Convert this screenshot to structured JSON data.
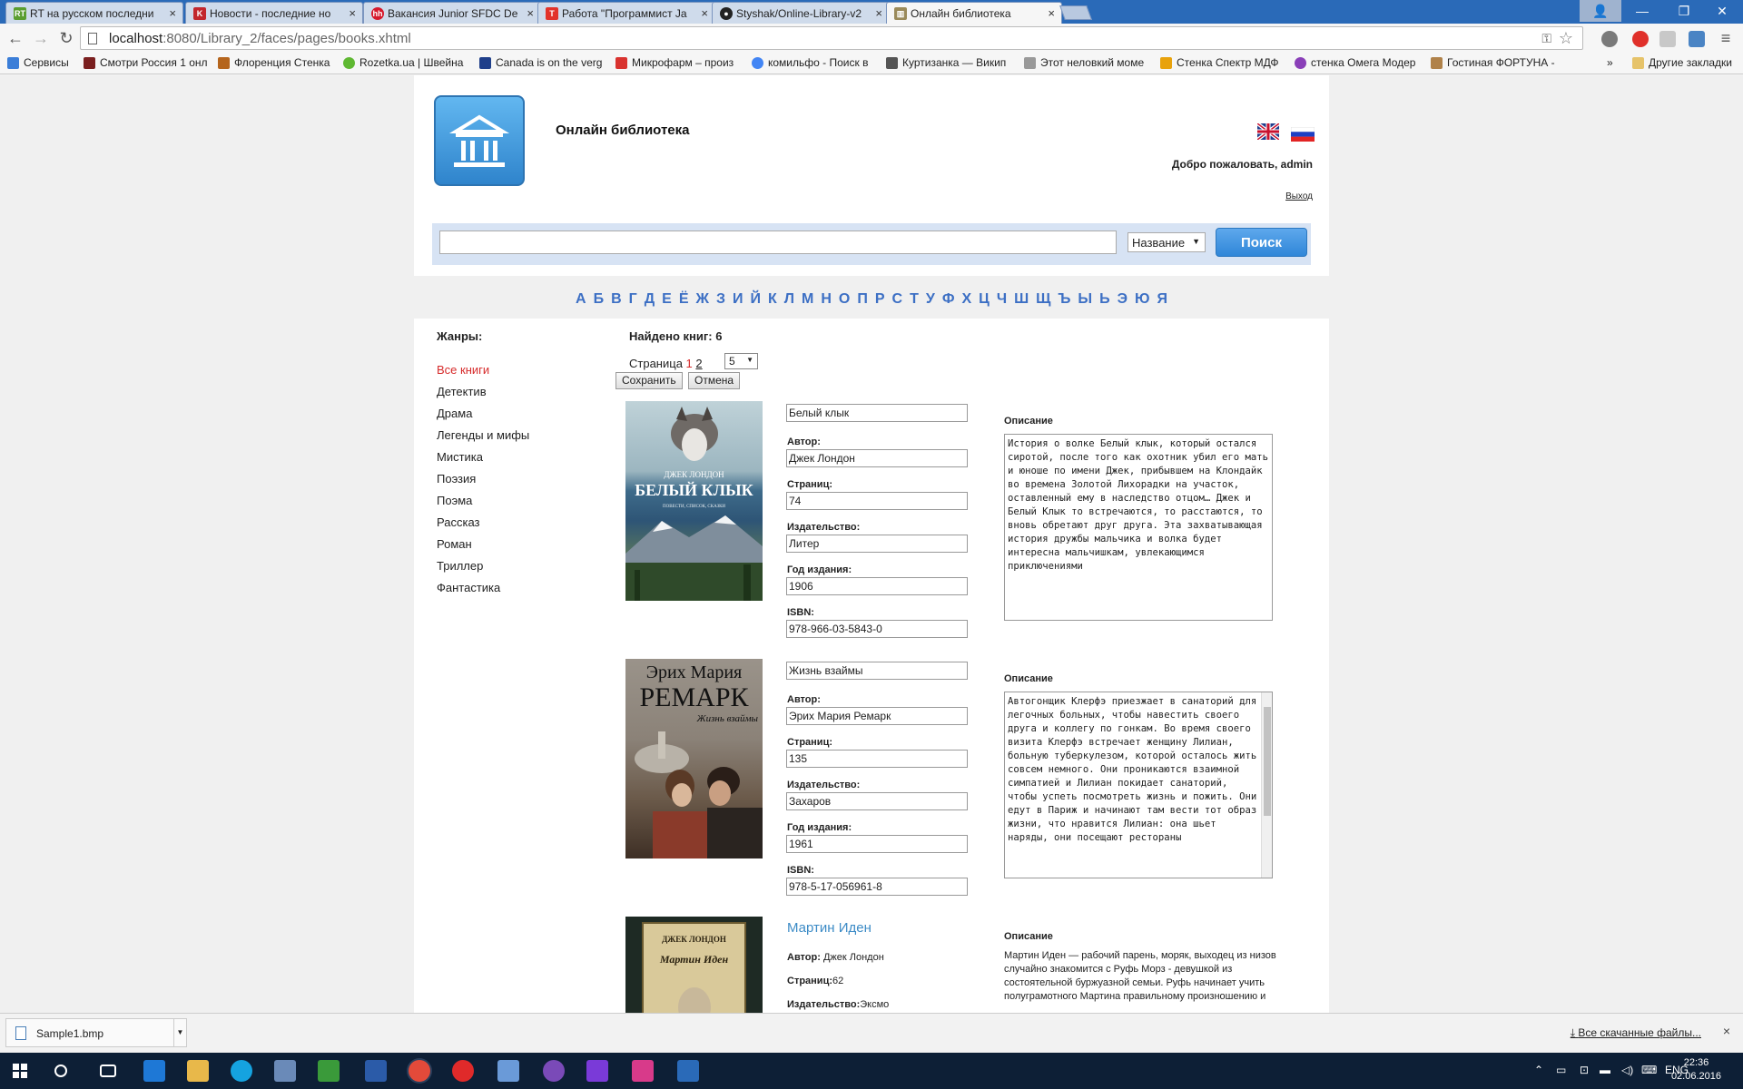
{
  "browser": {
    "tabs": [
      {
        "label": "RT на русском последни",
        "icon": "rt-favicon",
        "color": "#5a9e2f"
      },
      {
        "label": "Новости - последние но",
        "icon": "k-favicon",
        "color": "#c2272d"
      },
      {
        "label": "Вакансия Junior SFDC De",
        "icon": "hh-favicon",
        "color": "#d6192c"
      },
      {
        "label": "Работа \"Программист Ja",
        "icon": "rabota-favicon",
        "color": "#e2332a"
      },
      {
        "label": "Styshak/Online-Library-v2",
        "icon": "github-favicon",
        "color": "#222222"
      },
      {
        "label": "Онлайн библиотека",
        "icon": "library-favicon",
        "color": "#9a8a5a",
        "active": true
      }
    ],
    "url_host": "localhost",
    "url_path": ":8080/Library_2/faces/pages/books.xhtml",
    "bookmarks": [
      {
        "label": "Сервисы",
        "icon": "apps-icon",
        "color": "#3b7ed8"
      },
      {
        "label": "Смотри Россия 1 онл",
        "icon": "russia1-favicon",
        "color": "#7a1f1f"
      },
      {
        "label": "Флоренция Стенка",
        "icon": "florence-favicon",
        "color": "#b5651d"
      },
      {
        "label": "Rozetka.ua | Швейна",
        "icon": "rozetka-favicon",
        "color": "#5fb832"
      },
      {
        "label": "Canada is on the verg",
        "icon": "wsws-favicon",
        "color": "#1f3f8a"
      },
      {
        "label": "Микрофарм – произ",
        "icon": "microfarm-favicon",
        "color": "#d9332f"
      },
      {
        "label": "комильфо - Поиск в",
        "icon": "google-favicon",
        "color": "#4285f4"
      },
      {
        "label": "Куртизанка — Викип",
        "icon": "wikipedia-favicon",
        "color": "#555555"
      },
      {
        "label": "Этот неловкий моме",
        "icon": "ex-favicon",
        "color": "#999999"
      },
      {
        "label": "Стенка Спектр МДФ",
        "icon": "m-favicon",
        "color": "#e8a20c"
      },
      {
        "label": "стенка Омега Модер",
        "icon": "omega-favicon",
        "color": "#8a3fb8"
      },
      {
        "label": "Гостиная ФОРТУНА -",
        "icon": "fortuna-favicon",
        "color": "#b0824a"
      }
    ],
    "other_bookmarks": "Другие закладки",
    "more_bookmarks": "»"
  },
  "site": {
    "title": "Онлайн библиотека",
    "welcome": "Добро пожаловать, admin",
    "logout": "Выход",
    "search_value": "",
    "search_field_selected": "Название",
    "search_button": "Поиск"
  },
  "alphabet": [
    "А",
    "Б",
    "В",
    "Г",
    "Д",
    "Е",
    "Ё",
    "Ж",
    "З",
    "И",
    "Й",
    "К",
    "Л",
    "М",
    "Н",
    "О",
    "П",
    "Р",
    "С",
    "Т",
    "У",
    "Ф",
    "Х",
    "Ц",
    "Ч",
    "Ш",
    "Щ",
    "Ъ",
    "Ы",
    "Ь",
    "Э",
    "Ю",
    "Я"
  ],
  "genres": {
    "title": "Жанры:",
    "items": [
      "Все книги",
      "Детектив",
      "Драма",
      "Легенды и мифы",
      "Мистика",
      "Поэзия",
      "Поэма",
      "Рассказ",
      "Роман",
      "Триллер",
      "Фантастика"
    ]
  },
  "results": {
    "found_label": "Найдено книг: 6",
    "page_label": "Страница",
    "pages": [
      "1",
      "2"
    ],
    "page_size": "5",
    "save_button": "Сохранить",
    "cancel_button": "Отмена"
  },
  "labels": {
    "author": "Автор:",
    "pages": "Страниц:",
    "publisher": "Издательство:",
    "year": "Год издания:",
    "isbn": "ISBN:",
    "description": "Описание"
  },
  "books": [
    {
      "title": "Белый клык",
      "author": "Джек Лондон",
      "pages": "74",
      "publisher": "Литер",
      "year": "1906",
      "isbn": "978-966-03-5843-0",
      "cover_author": "ДЖЕК ЛОНДОН",
      "cover_title": "БЕЛЫЙ КЛЫК",
      "cover_subtitle": "ПОВЕСТИ, СПИСОК, СКАЗКИ",
      "description": "История о волке Белый клык, который остался сиротой, после того как охотник убил его мать и юноше по имени Джек, прибывшем на Клондайк во времена Золотой Лихорадки на участок, оставленный ему в наследство отцом… Джек и Белый Клык то встречаются, то расстаются, то вновь обретают друг друга. Эта захватывающая история дружбы мальчика и волка будет интересна мальчишкам, увлекающимся приключениями"
    },
    {
      "title": "Жизнь взаймы",
      "author": "Эрих Мария Ремарк",
      "pages": "135",
      "publisher": "Захаров",
      "year": "1961",
      "isbn": "978-5-17-056961-8",
      "cover_author": "Эрих Мария",
      "cover_title": "РЕМАРК",
      "cover_subtitle": "Жизнь взаймы",
      "description": "Автогонщик Клерфэ приезжает в санаторий для легочных больных, чтобы навестить своего друга и коллегу по гонкам. Во время своего визита Клерфэ встречает женщину Лилиан, больную туберкулезом, которой осталось жить совсем немного. Они проникаются взаимной симпатией и Лилиан покидает санаторий, чтобы успеть посмотреть жизнь и пожить. Они едут в Париж и начинают там вести тот образ жизни, что нравится Лилиан: она шьет наряды, они посещают рестораны"
    },
    {
      "title": "Мартин Иден",
      "author": "Джек Лондон",
      "pages": "62",
      "publisher": "Эксмо",
      "cover_author": "ДЖЕК ЛОНДОН",
      "cover_title": "Мартин Иден",
      "description": "Мартин Иден — рабочий парень, моряк, выходец из низов случайно знакомится с Руфь Морз - девушкой из состоятельной буржуазной семьи. Руфь начинает учить полуграмотного Мартина правильному произношению и"
    }
  ],
  "download_bar": {
    "file": "Sample1.bmp",
    "show_all": "Все скачанные файлы...",
    "close": "×"
  },
  "taskbar": {
    "lang": "ENG",
    "time": "22:36",
    "date": "02.06.2016"
  },
  "colors": {
    "accent": "#3c6fc4",
    "active_genre": "#d62a2a",
    "search_button": "#2f86d8",
    "book_link": "#3c8bc6"
  }
}
